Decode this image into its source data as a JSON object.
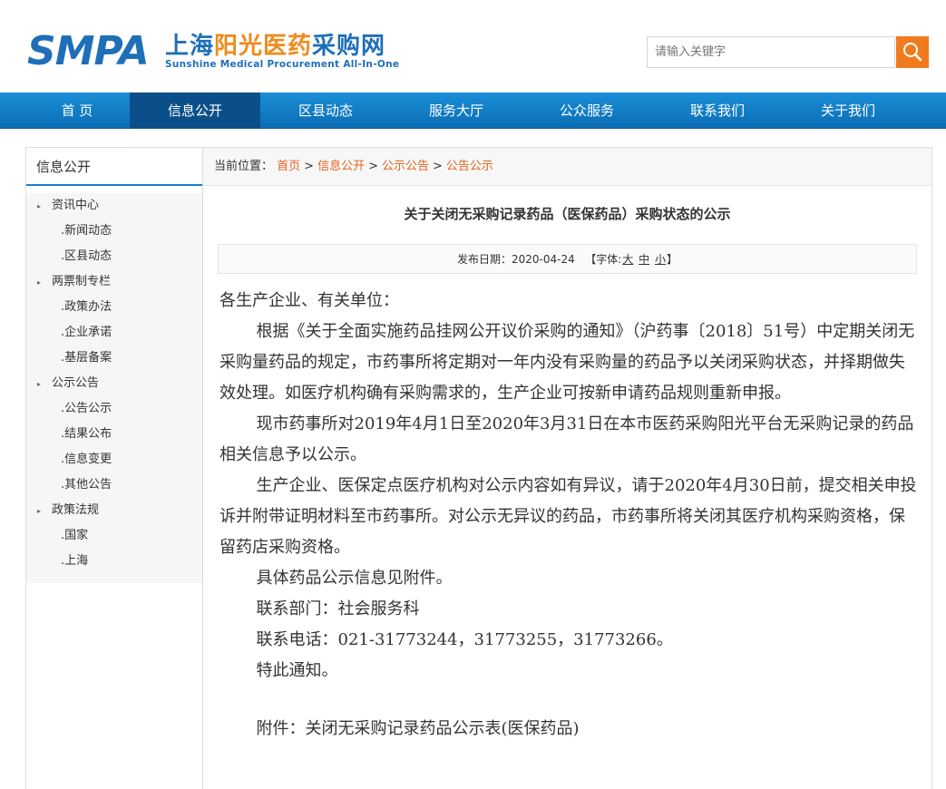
{
  "header": {
    "logo_smpa": "SMPA",
    "logo_cn_1": "上海",
    "logo_cn_2": "阳光医药",
    "logo_cn_3": "采购网",
    "logo_en": "Sunshine Medical Procurement All-In-One",
    "search_placeholder": "请输入关键字",
    "search_icon": "search-icon",
    "accent_color": "#f07b1f",
    "brand_color": "#1f6fb8"
  },
  "nav": {
    "items": [
      "首 页",
      "信息公开",
      "区县动态",
      "服务大厅",
      "公众服务",
      "联系我们",
      "关于我们"
    ],
    "active": "信息公开",
    "bar_color": "#1480c8"
  },
  "sidebar": {
    "title": "信息公开",
    "items": [
      {
        "label": "资讯中心",
        "type": "group"
      },
      {
        "label": ".新闻动态",
        "type": "sub"
      },
      {
        "label": ".区县动态",
        "type": "sub"
      },
      {
        "label": "两票制专栏",
        "type": "group"
      },
      {
        "label": ".政策办法",
        "type": "sub"
      },
      {
        "label": ".企业承诺",
        "type": "sub"
      },
      {
        "label": ".基层备案",
        "type": "sub"
      },
      {
        "label": "公示公告",
        "type": "group"
      },
      {
        "label": ".公告公示",
        "type": "sub"
      },
      {
        "label": ".结果公布",
        "type": "sub"
      },
      {
        "label": ".信息变更",
        "type": "sub"
      },
      {
        "label": ".其他公告",
        "type": "sub"
      },
      {
        "label": "政策法规",
        "type": "group"
      },
      {
        "label": ".国家",
        "type": "sub"
      },
      {
        "label": ".上海",
        "type": "sub"
      }
    ]
  },
  "breadcrumb": {
    "prefix": "当前位置：",
    "items": [
      "首页",
      "信息公开",
      "公示公告",
      "公告公示"
    ],
    "sep": ">"
  },
  "article": {
    "title": "关于关闭无采购记录药品（医保药品）采购状态的公示",
    "date_label": "发布日期：2020-04-24",
    "font_label": "【字体:",
    "font_large": "大",
    "font_medium": "中",
    "font_small": "小",
    "font_close": "】",
    "paragraphs": [
      "各生产企业、有关单位：",
      "根据《关于全面实施药品挂网公开议价采购的通知》（沪药事〔2018〕51号）中定期关闭无采购量药品的规定，市药事所将定期对一年内没有采购量的药品予以关闭采购状态，并择期做失效处理。如医疗机构确有采购需求的，生产企业可按新申请药品规则重新申报。",
      "现市药事所对2019年4月1日至2020年3月31日在本市医药采购阳光平台无采购记录的药品相关信息予以公示。",
      "生产企业、医保定点医疗机构对公示内容如有异议，请于2020年4月30日前，提交相关申投诉并附带证明材料至市药事所。对公示无异议的药品，市药事所将关闭其医疗机构采购资格，保留药店采购资格。",
      "具体药品公示信息见附件。",
      "联系部门：社会服务科",
      "联系电话：021-31773244，31773255，31773266。",
      "特此通知。"
    ],
    "attachment": "附件：关闭无采购记录药品公示表(医保药品)"
  }
}
